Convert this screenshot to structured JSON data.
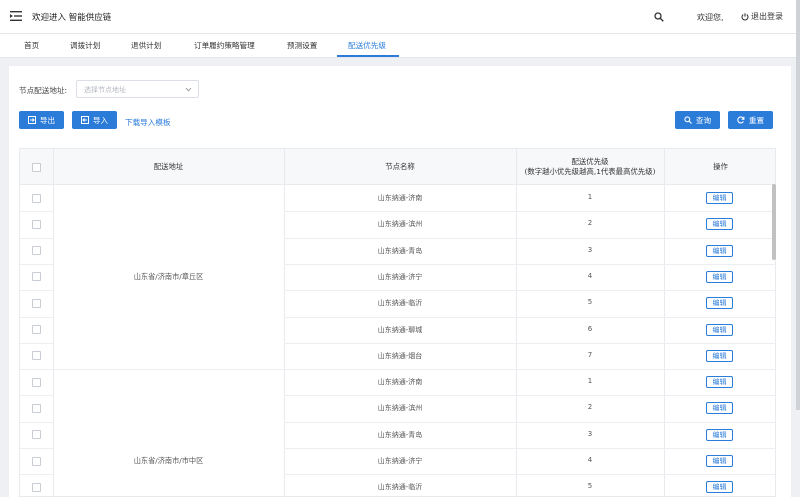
{
  "header": {
    "title": "欢迎进入 智能供应链",
    "greeting": "欢迎您,",
    "logout_label": "退出登录"
  },
  "tabs": [
    {
      "label": "首页"
    },
    {
      "label": "调拨计划"
    },
    {
      "label": "退供计划"
    },
    {
      "label": "订单履约策略管理"
    },
    {
      "label": "预测设置"
    },
    {
      "label": "配送优先级"
    }
  ],
  "active_tab": "配送优先级",
  "filters": {
    "address_label": "节点配送地址:",
    "address_placeholder": "选择节点地址"
  },
  "toolbar": {
    "export_label": "导出",
    "import_label": "导入",
    "template_link": "下载导入模板",
    "query_label": "查询",
    "reset_label": "重置"
  },
  "table": {
    "headers": {
      "address": "配送地址",
      "node": "节点名称",
      "priority": "配送优先级",
      "priority_note": "(数字越小优先级越高,1代表最高优先级)",
      "action": "操作"
    },
    "edit_label": "编辑",
    "groups": [
      {
        "address": "山东省/济南市/章丘区",
        "rows": [
          {
            "node": "山东纳通-济南",
            "priority": "1"
          },
          {
            "node": "山东纳通-滨州",
            "priority": "2"
          },
          {
            "node": "山东纳通-青岛",
            "priority": "3"
          },
          {
            "node": "山东纳通-济宁",
            "priority": "4"
          },
          {
            "node": "山东纳通-临沂",
            "priority": "5"
          },
          {
            "node": "山东纳通-聊城",
            "priority": "6"
          },
          {
            "node": "山东纳通-烟台",
            "priority": "7"
          }
        ]
      },
      {
        "address": "山东省/济南市/市中区",
        "rows": [
          {
            "node": "山东纳通-济南",
            "priority": "1"
          },
          {
            "node": "山东纳通-滨州",
            "priority": "2"
          },
          {
            "node": "山东纳通-青岛",
            "priority": "3"
          },
          {
            "node": "山东纳通-济宁",
            "priority": "4"
          },
          {
            "node": "山东纳通-临沂",
            "priority": "5"
          }
        ]
      }
    ]
  },
  "colors": {
    "accent": "#2b7bd8",
    "background": "#eef0f3"
  },
  "icons": {
    "menu": "menu-fold-icon",
    "search": "search-icon",
    "logout": "power-icon",
    "export": "export-icon",
    "import": "import-icon",
    "query": "search-icon",
    "reset": "refresh-icon",
    "dropdown": "chevron-down-icon"
  }
}
